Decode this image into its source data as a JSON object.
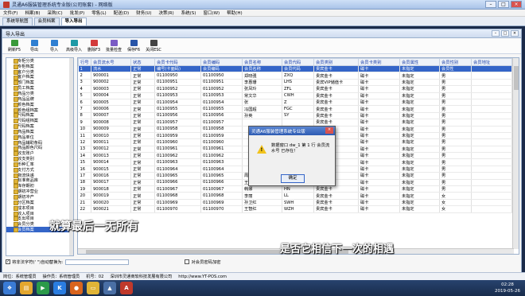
{
  "window": {
    "title": "灵通A6服装管理系统专业版(公司账套) - 网络版"
  },
  "menu": [
    "文件(F)",
    "档案(B)",
    "采购(C)",
    "批发(P)",
    "零售(L)",
    "配送(D)",
    "财务(U)",
    "决策(R)",
    "系统(S)",
    "窗口(W)",
    "帮助(H)"
  ],
  "tabs": [
    "系统导航图",
    "会员档案",
    "导入导出"
  ],
  "panel": {
    "title": "导入导出"
  },
  "toolbar": [
    "刷新F5",
    "导出",
    "导入",
    "高级导入",
    "删除F3",
    "批量检查",
    "保存F6",
    "关闭ESC"
  ],
  "tree": {
    "items": [
      "专柜分类",
      "专柜档案",
      "客户分类",
      "客户档案",
      "部门档案",
      "员工档案",
      "商品分类",
      "商品品牌",
      "颜色档案",
      "颜色组档案",
      "尺码档案",
      "尺码组档案",
      "尺码档案",
      "商品档案",
      "商品单位",
      "商品辅助条码",
      "商品颜色尺码",
      "收支账户",
      "收支类别",
      "币种汇率",
      "支付方式",
      "物流快递",
      "标准商品库",
      "库存期初",
      "期初冲营业",
      "期初冲产",
      "分区档案",
      "成本项目",
      "收入项目",
      "支出项目",
      "会员分类",
      "会员档案"
    ],
    "selected_index": 31
  },
  "grid": {
    "columns": [
      "行号",
      "会员流水号",
      "状态",
      "会员卡代码",
      "会员编码",
      "会员名称",
      "会员代码",
      "会员类别",
      "会员卡类别",
      "会员属性",
      "会员性别",
      "会员地址"
    ],
    "rows": [
      [
        "1",
        "流水",
        "正常",
        "编号(卡面码)",
        "会员编码",
        "会员名称",
        "会员代码",
        "贵宾金卡",
        "磁卡",
        "未指定",
        "会员性",
        ""
      ],
      [
        "2",
        "900001",
        "正常",
        "01100950",
        "01100950",
        "郑晓强",
        "ZXQ",
        "贵宾金卡",
        "磁卡",
        "未指定",
        "男",
        ""
      ],
      [
        "3",
        "900002",
        "正常",
        "01100951",
        "01100951",
        "李惠珊",
        "LHS",
        "贵宾VIP储值卡",
        "磁卡",
        "未指定",
        "男",
        ""
      ],
      [
        "4",
        "900003",
        "正常",
        "01100952",
        "01100952",
        "张凤玲",
        "ZFL",
        "贵宾金卡",
        "磁卡",
        "未指定",
        "男",
        ""
      ],
      [
        "5",
        "900004",
        "正常",
        "01100953",
        "01100953",
        "常文华",
        "CWH",
        "贵宾金卡",
        "磁卡",
        "未指定",
        "男",
        ""
      ],
      [
        "6",
        "900005",
        "正常",
        "01100954",
        "01100954",
        "张",
        "Z",
        "贵宾金卡",
        "磁卡",
        "未指定",
        "男",
        ""
      ],
      [
        "7",
        "900006",
        "正常",
        "01100955",
        "01100955",
        "冯国超",
        "FGC",
        "贵宾金卡",
        "磁卡",
        "未指定",
        "男",
        ""
      ],
      [
        "8",
        "900007",
        "正常",
        "01100956",
        "01100956",
        "孙英",
        "SY",
        "贵宾金卡",
        "磁卡",
        "未指定",
        "男",
        ""
      ],
      [
        "9",
        "900008",
        "正常",
        "01100957",
        "01100957",
        "",
        "",
        "贵宾金卡",
        "磁卡",
        "未指定",
        "男",
        ""
      ],
      [
        "10",
        "900009",
        "正常",
        "01100958",
        "01100958",
        "",
        "",
        "贵宾金卡",
        "磁卡",
        "未指定",
        "男",
        ""
      ],
      [
        "11",
        "900010",
        "正常",
        "01100959",
        "01100959",
        "",
        "",
        "贵宾金卡",
        "磁卡",
        "未指定",
        "男",
        ""
      ],
      [
        "12",
        "900011",
        "正常",
        "01100960",
        "01100960",
        "",
        "",
        "贵宾金卡",
        "磁卡",
        "未指定",
        "男",
        ""
      ],
      [
        "13",
        "900012",
        "正常",
        "01100961",
        "01100961",
        "",
        "",
        "贵宾金卡",
        "磁卡",
        "未指定",
        "男",
        ""
      ],
      [
        "14",
        "900013",
        "正常",
        "01100962",
        "01100962",
        "",
        "",
        "贵宾金卡",
        "磁卡",
        "未指定",
        "男",
        ""
      ],
      [
        "15",
        "900014",
        "正常",
        "01100963",
        "01100963",
        "",
        "",
        "贵宾金卡",
        "磁卡",
        "未指定",
        "男",
        ""
      ],
      [
        "16",
        "900015",
        "正常",
        "01100964",
        "01100964",
        "",
        "",
        "贵宾金卡",
        "磁卡",
        "未指定",
        "男",
        ""
      ],
      [
        "17",
        "900016",
        "正常",
        "01100965",
        "01100965",
        "周海玲",
        "ZHL",
        "贵宾金卡",
        "磁卡",
        "未指定",
        "男",
        ""
      ],
      [
        "18",
        "900017",
        "正常",
        "01100966",
        "01100966",
        "王红卫",
        "WHW",
        "贵宾金卡",
        "磁卡",
        "未指定",
        "男",
        ""
      ],
      [
        "19",
        "900018",
        "正常",
        "01100967",
        "01100967",
        "韩娜",
        "HN",
        "贵宾金卡",
        "磁卡",
        "未指定",
        "男",
        ""
      ],
      [
        "20",
        "900019",
        "正常",
        "01100968",
        "01100968",
        "李丽",
        "LL",
        "贵宾金卡",
        "磁卡",
        "未指定",
        "女",
        ""
      ],
      [
        "21",
        "900020",
        "正常",
        "01100969",
        "01100969",
        "孙卫红",
        "SWH",
        "贵宾金卡",
        "磁卡",
        "未指定",
        "女",
        ""
      ],
      [
        "22",
        "900021",
        "正常",
        "01100970",
        "01100970",
        "王智红",
        "WZH",
        "贵宾金卡",
        "磁卡",
        "未指定",
        "女",
        ""
      ]
    ]
  },
  "options": {
    "replace_label": "将非法字符(' \")自动替换为:",
    "password_label": "对会员密码加密"
  },
  "dialog": {
    "title": "灵通A6服装管理系统专业版",
    "message": "数据窗口 dw_1 第 1 行 会员流水号 已存在！",
    "ok_label": "确定"
  },
  "captions": {
    "left": "就算最后一无所有",
    "right": "是否它相信下一次的相遇"
  },
  "status": {
    "user": "岗位：系统管理员",
    "operator": "操作员：系统管理员",
    "machine": "机号：02",
    "company": "深圳市灵通商软科技发展有限公司",
    "url": "http://www.YT-POS.com"
  },
  "clock": {
    "time": "02:28",
    "date": "2019-05-26"
  }
}
